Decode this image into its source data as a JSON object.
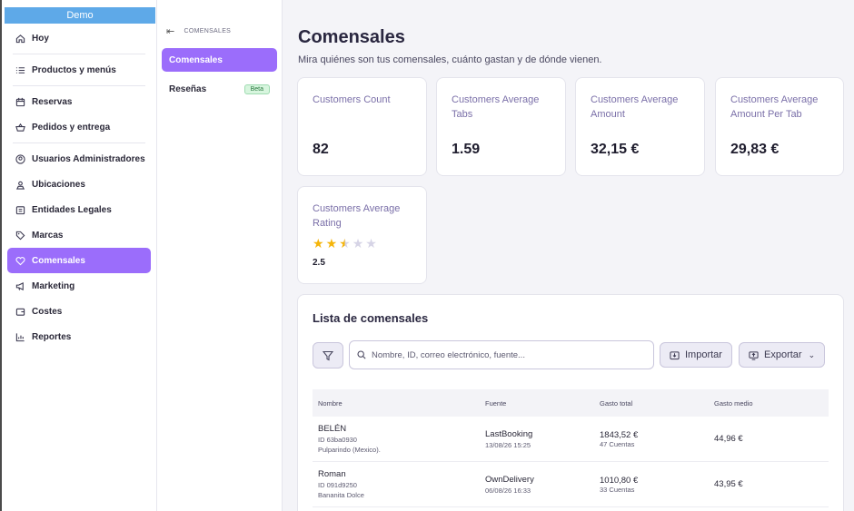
{
  "app": {
    "workspace_label": "Demo"
  },
  "sidebar": {
    "items": [
      {
        "label": "Hoy",
        "icon": "home-icon"
      },
      {
        "label": "Productos y menús",
        "icon": "list-icon"
      },
      {
        "label": "Reservas",
        "icon": "calendar-icon"
      },
      {
        "label": "Pedidos y entrega",
        "icon": "basket-icon"
      },
      {
        "label": "Usuarios Administradores",
        "icon": "user-circle-icon"
      },
      {
        "label": "Ubicaciones",
        "icon": "location-icon"
      },
      {
        "label": "Entidades Legales",
        "icon": "building-icon"
      },
      {
        "label": "Marcas",
        "icon": "tag-icon"
      },
      {
        "label": "Comensales",
        "icon": "heart-icon",
        "active": true
      },
      {
        "label": "Marketing",
        "icon": "megaphone-icon"
      },
      {
        "label": "Costes",
        "icon": "wallet-icon"
      },
      {
        "label": "Reportes",
        "icon": "chart-icon"
      }
    ]
  },
  "subnav": {
    "header": "COMENSALES",
    "items": [
      {
        "label": "Comensales",
        "active": true
      },
      {
        "label": "Reseñas",
        "badge": "Beta"
      }
    ]
  },
  "page": {
    "title": "Comensales",
    "subtitle": "Mira quiénes son tus comensales, cuánto gastan y de dónde vienen."
  },
  "metrics": [
    {
      "label": "Customers Count",
      "value": "82"
    },
    {
      "label": "Customers Average Tabs",
      "value": "1.59"
    },
    {
      "label": "Customers Average Amount",
      "value": "32,15 €"
    },
    {
      "label": "Customers Average Amount Per Tab",
      "value": "29,83 €"
    }
  ],
  "rating": {
    "label": "Customers Average Rating",
    "value": "2.5",
    "stars_filled": 2.5,
    "stars_total": 5
  },
  "list": {
    "title": "Lista de comensales",
    "search_placeholder": "Nombre, ID, correo electrónico, fuente...",
    "import_label": "Importar",
    "export_label": "Exportar",
    "columns": [
      "Nombre",
      "Fuente",
      "Gasto total",
      "Gasto medio"
    ],
    "rows": [
      {
        "name": "BELÉN",
        "id": "ID 63ba0930",
        "place": "Pulparindo (Mexico).",
        "source": "LastBooking",
        "source_date": "13/08/26 15:25",
        "total": "1843,52 €",
        "visits": "47 Cuentas",
        "avg": "44,96 €"
      },
      {
        "name": "Roman",
        "id": "ID 091d9250",
        "place": "Bananita Dolce",
        "source": "OwnDelivery",
        "source_date": "06/08/26 16:33",
        "total": "1010,80 €",
        "visits": "33 Cuentas",
        "avg": "43,95 €"
      }
    ]
  },
  "colors": {
    "accent": "#9b6dfb",
    "demo_bar": "#5ea9e8",
    "star": "#f5b50a"
  }
}
